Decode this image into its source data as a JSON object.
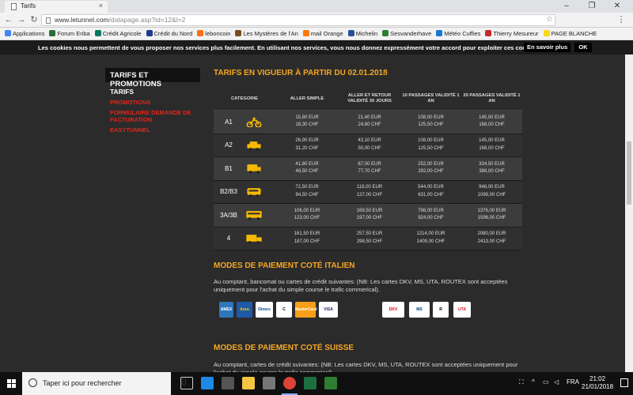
{
  "browser": {
    "tab_title": "Tarifs",
    "tab_close": "×",
    "url_host": "www.letunnel.com",
    "url_rest": "/datapage.asp?id=12&l=2",
    "bookmarks": [
      {
        "label": "Applications",
        "color": "#4285f4"
      },
      {
        "label": "Forum Eriba",
        "color": "#2a6f3a"
      },
      {
        "label": "Crédit Agricole",
        "color": "#007a5e"
      },
      {
        "label": "Crédit du Nord",
        "color": "#1e3a8a"
      },
      {
        "label": "leboncoin",
        "color": "#ff6e14"
      },
      {
        "label": "Les Mystères de l'An",
        "color": "#7a4b1e"
      },
      {
        "label": "mail Orange",
        "color": "#ff7900"
      },
      {
        "label": "Michelin",
        "color": "#27509b"
      },
      {
        "label": "Sesvanderhave",
        "color": "#2e7d32"
      },
      {
        "label": "Météo Cuffies",
        "color": "#1976d2"
      },
      {
        "label": "Thierry Mesureur",
        "color": "#c62828"
      },
      {
        "label": "PAGE BLANCHE",
        "color": "#f9d71c"
      }
    ]
  },
  "cookie": {
    "text": "Les cookies nous permettent de vous proposer nos services plus facilement. En utilisant nos services, vous nous donnez expressément votre accord pour exploiter ces cookies.",
    "more_label": "En savoir plus",
    "ok_label": "OK"
  },
  "sidebar": {
    "title": "TARIFS ET PROMOTIONS",
    "links": [
      {
        "label": "TARIFS",
        "active": true
      },
      {
        "label": "PROMOTIONS",
        "active": false
      },
      {
        "label": "FORMULAIRE DEMANDE DE FACTURATION",
        "active": false
      },
      {
        "label": "EASYTUNNEL",
        "active": false
      }
    ]
  },
  "main": {
    "title": "TARIFS EN VIGUEUR À PARTIR DU 02.01.2018",
    "table": {
      "headers": [
        "CATEGORIE",
        "ALLER SIMPLE",
        "ALLER ET RETOUR VALIDITÉ 30 JOURS",
        "10 PASSAGES VALIDITÉ 1 AN",
        "20 PASSAGES VALIDITÉ 1 AN"
      ],
      "rows": [
        {
          "cat": "A1",
          "icon": "motorcycle-icon",
          "prices": [
            [
              "15,80 EUR",
              "18,30 CHF"
            ],
            [
              "21,40 EUR",
              "24,80 CHF"
            ],
            [
              "108,00 EUR",
              "125,50 CHF"
            ],
            [
              "145,00 EUR",
              "168,00 CHF"
            ]
          ]
        },
        {
          "cat": "A2",
          "icon": "car-icon",
          "prices": [
            [
              "26,90 EUR",
              "31,20 CHF"
            ],
            [
              "43,10 EUR",
              "50,00 CHF"
            ],
            [
              "108,00 EUR",
              "125,50 CHF"
            ],
            [
              "145,00 EUR",
              "168,00 CHF"
            ]
          ]
        },
        {
          "cat": "B1",
          "icon": "van-icon",
          "prices": [
            [
              "41,80 EUR",
              "48,50 CHF"
            ],
            [
              "67,00 EUR",
              "77,70 CHF"
            ],
            [
              "252,00 EUR",
              "292,00 CHF"
            ],
            [
              "334,50 EUR",
              "388,00 CHF"
            ]
          ]
        },
        {
          "cat": "B2/B3",
          "icon": "minibus-icon",
          "prices": [
            [
              "72,50 EUR",
              "84,50 CHF"
            ],
            [
              "118,00 EUR",
              "137,00 CHF"
            ],
            [
              "544,00 EUR",
              "631,00 CHF"
            ],
            [
              "948,00 EUR",
              "1099,00 CHF"
            ]
          ]
        },
        {
          "cat": "3A/3B",
          "icon": "bus-icon",
          "prices": [
            [
              "106,00 EUR",
              "123,00 CHF"
            ],
            [
              "169,50 EUR",
              "197,00 CHF"
            ],
            [
              "796,00 EUR",
              "924,00 CHF"
            ],
            [
              "1376,00 EUR",
              "1596,00 CHF"
            ]
          ]
        },
        {
          "cat": "4",
          "icon": "truck-icon",
          "prices": [
            [
              "161,50 EUR",
              "187,00 CHF"
            ],
            [
              "257,50 EUR",
              "298,50 CHF"
            ],
            [
              "1214,00 EUR",
              "1409,00 CHF"
            ],
            [
              "2080,00 EUR",
              "2413,00 CHF"
            ]
          ]
        }
      ]
    },
    "pay_it_title": "MODES DE PAIEMENT COTÉ ITALIEN",
    "pay_it_text": "Au comptant, bancomat ou cartes de crédit suivantes: (NB: Les cartes DKV, MS, UTA, ROUTEX sont acceptées uniquement pour l'achat du simple course le trafic commerical).",
    "pay_logos": [
      {
        "label": "AMEX",
        "bg": "#2e77bb",
        "fg": "#fff"
      },
      {
        "label": "Aura",
        "bg": "#1e5aa8",
        "fg": "#ffcc00"
      },
      {
        "label": "Diners",
        "bg": "#ffffff",
        "fg": "#004a97"
      },
      {
        "label": "C",
        "bg": "#ffffff",
        "fg": "#000"
      },
      {
        "label": "MasterCard",
        "bg": "#f79e1b",
        "fg": "#fff"
      },
      {
        "label": "VISA",
        "bg": "#ffffff",
        "fg": "#1a1f71"
      },
      {
        "label": "DKV",
        "bg": "#ffffff",
        "fg": "#e2001a"
      },
      {
        "label": "MS",
        "bg": "#ffffff",
        "fg": "#003d7c"
      },
      {
        "label": "R",
        "bg": "#ffffff",
        "fg": "#000"
      },
      {
        "label": "UTA",
        "bg": "#ffffff",
        "fg": "#d7141a"
      }
    ],
    "pay_ch_title": "MODES DE PAIEMENT COTÉ SUISSE",
    "pay_ch_text": "Au comptant, cartes de crédit suivantes: (NB: Les cartes DKV, MS, UTA, ROUTEX sont acceptées uniquement pour l'achat du simple course le trafic commerical)."
  },
  "taskbar": {
    "search_placeholder": "Taper ici pour rechercher",
    "lang": "FRA",
    "time": "21:02",
    "date": "21/01/2018"
  },
  "colors": {
    "accent": "#f5a623",
    "link_red": "#e1261c"
  }
}
